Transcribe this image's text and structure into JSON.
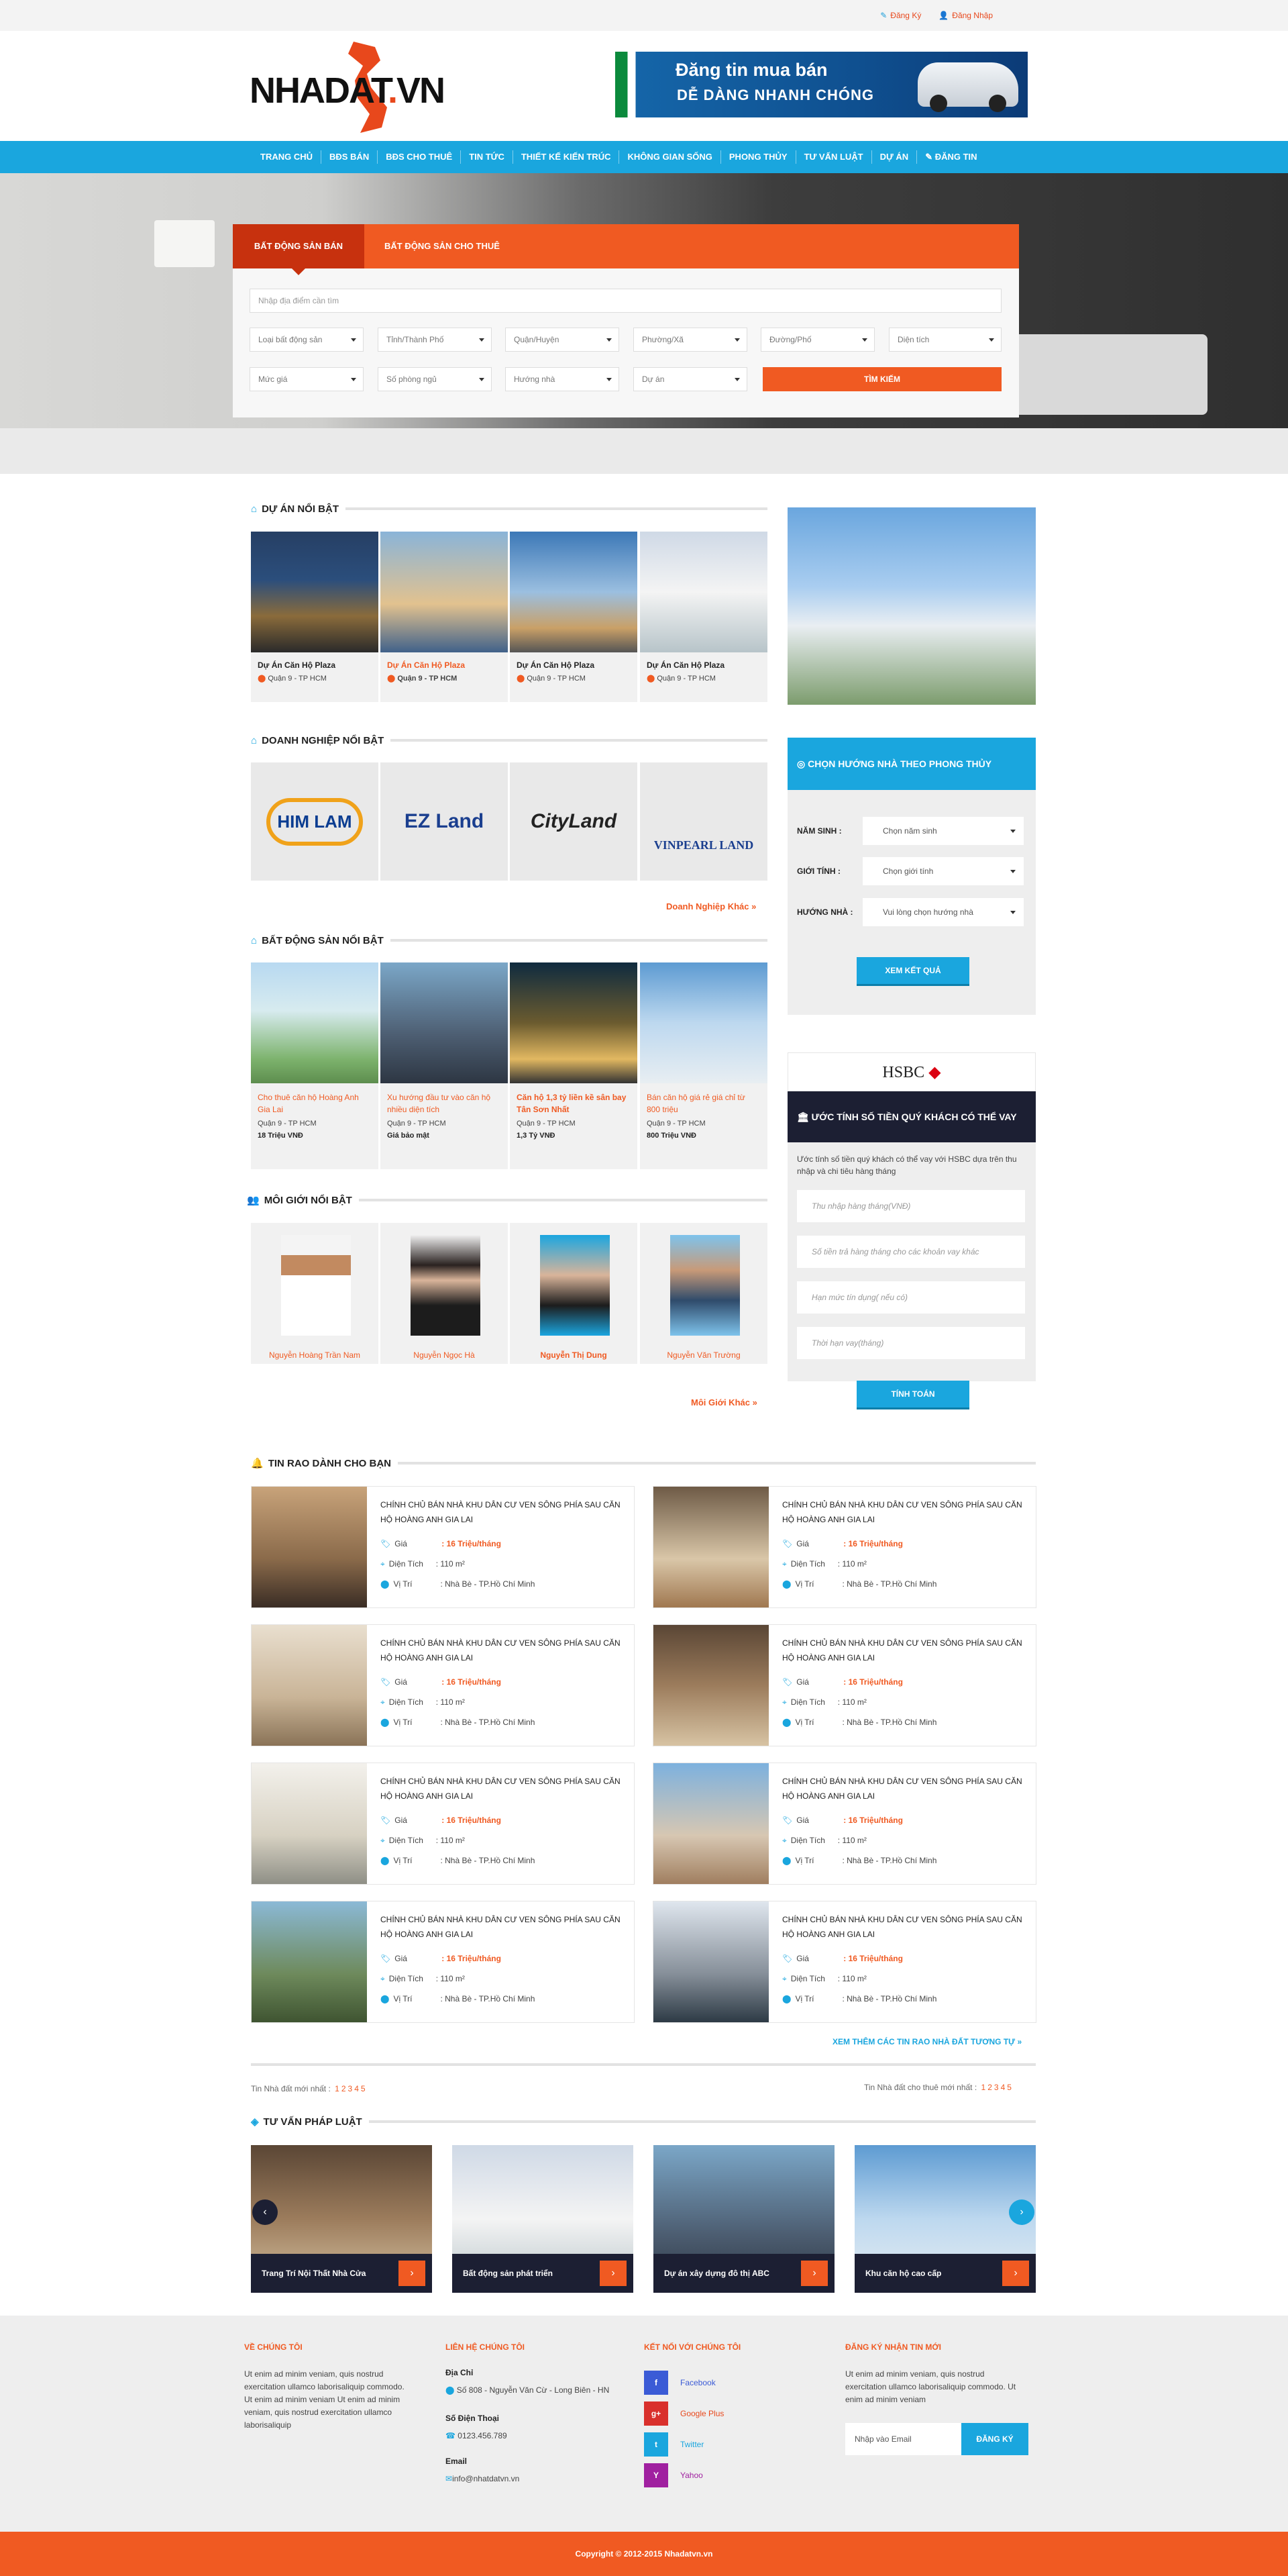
{
  "top": {
    "register": "Đăng Ký",
    "login": "Đăng Nhập"
  },
  "logo": {
    "main": "NHADAT",
    "dot": ".",
    "tld": "VN"
  },
  "banner": {
    "line1": "Đăng tin mua bán",
    "line2": "DỄ DÀNG  NHANH CHÓNG"
  },
  "nav": [
    "TRANG CHỦ",
    "BĐS BÁN",
    "BĐS CHO THUÊ",
    "TIN TỨC",
    "THIẾT KẾ KIẾN TRÚC",
    "KHÔNG GIAN SỐNG",
    "PHONG THỦY",
    "TƯ VẤN LUẬT",
    "DỰ ÁN",
    "ĐĂNG TIN"
  ],
  "search": {
    "tab_sale": "BẤT ĐỘNG SẢN BÁN",
    "tab_rent": "BẤT ĐỘNG SẢN CHO THUÊ",
    "placeholder": "Nhập địa điểm cần tìm",
    "filters_row1": [
      "Loại bất động sản",
      "Tỉnh/Thành Phố",
      "Quận/Huyện",
      "Phường/Xã",
      "Đường/Phố",
      "Diện tích"
    ],
    "filters_row2": [
      "Mức giá",
      "Số phòng ngủ",
      "Hướng nhà",
      "Dự án"
    ],
    "button": "TÌM KIẾM"
  },
  "projects": {
    "heading": "DỰ ÁN NỔI BẬT",
    "items": [
      {
        "title": "Dự Án Căn Hộ Plaza",
        "loc": "Quận 9 - TP HCM"
      },
      {
        "title": "Dự Án Căn Hộ Plaza",
        "loc": "Quận 9 - TP HCM"
      },
      {
        "title": "Dự Án Căn Hộ Plaza",
        "loc": "Quận 9 - TP HCM"
      },
      {
        "title": "Dự Án Căn Hộ Plaza",
        "loc": "Quận 9 - TP HCM"
      }
    ]
  },
  "enterprises": {
    "heading": "DOANH NGHIỆP NỔI BẬT",
    "logos": [
      "HIM LAM",
      "EZ Land",
      "CityLand",
      "VINPEARL LAND"
    ],
    "more": "Doanh Nghiệp Khác »"
  },
  "featured": {
    "heading": "BẤT ĐỘNG SẢN NỔI BẬT",
    "items": [
      {
        "title": "Cho thuê căn hộ Hoàng Anh Gia Lai",
        "loc": "Quận 9 - TP HCM",
        "price": "18 Triệu VNĐ"
      },
      {
        "title": "Xu hướng đầu tư vào căn hộ nhiều diện tích",
        "loc": "Quận 9 - TP HCM",
        "price": "Giá bảo mật"
      },
      {
        "title": "Căn hộ 1,3 tỷ liền kề sân bay Tân Sơn Nhất",
        "loc": "Quận 9 - TP HCM",
        "price": "1,3 Tỷ VNĐ"
      },
      {
        "title": "Bán căn hộ giá rẻ giá chỉ từ 800 triệu",
        "loc": "Quận 9 - TP HCM",
        "price": "800 Triệu VNĐ"
      }
    ]
  },
  "brokers": {
    "heading": "MÔI GIỚI NỔI BẬT",
    "names": [
      "Nguyễn Hoàng Trần Nam",
      "Nguyễn Ngọc Hà",
      "Nguyễn Thị Dung",
      "Nguyễn Văn Trường"
    ],
    "more": "Môi Giới Khác »"
  },
  "fengshui": {
    "heading": "CHỌN HƯỚNG NHÀ THEO PHONG THỦY",
    "labels": [
      "NĂM SINH :",
      "GIỚI TÍNH :",
      "HƯỚNG NHÀ :"
    ],
    "selects": [
      "Chọn năm sinh",
      "Chọn giới tính",
      "Vui lòng chọn hướng nhà"
    ],
    "button": "XEM KẾT QUẢ"
  },
  "hsbc": {
    "logo": "HSBC",
    "heading": "ƯỚC TÍNH SỐ TIỀN QUÝ KHÁCH CÓ THỂ VAY",
    "desc": "Ước tính số tiền quý khách có thể vay với HSBC dựa trên thu nhập và chi tiêu hàng tháng",
    "inputs": [
      "Thu nhập hàng tháng(VNĐ)",
      "Số tiền trả hàng tháng cho các khoản vay khác",
      "Hạn mức tín dụng( nếu có)",
      "Thời hạn vay(tháng)"
    ],
    "button": "TÍNH TOÁN"
  },
  "listings": {
    "heading": "TIN RAO DÀNH CHO BẠN",
    "title": "CHÍNH CHỦ BÁN NHÀ KHU DÂN CƯ VEN SÔNG PHÍA SAU CĂN HỘ HOÀNG ANH GIA LAI",
    "price_label": "Giá",
    "price": ": 16 Triệu/tháng",
    "area_label": "Diện Tích",
    "area": ": 110 m²",
    "loc_label": "Vị Trí",
    "loc": ": Nhà Bè - TP.Hồ Chí Minh",
    "more": "XEM THÊM CÁC TIN RAO NHÀ ĐẤT TƯƠNG TỰ »",
    "pag_left": "Tin Nhà đất mới nhất :",
    "pag_right": "Tin Nhà đất cho thuê mới nhất :",
    "pages": [
      "1",
      "2",
      "3",
      "4",
      "5"
    ]
  },
  "legal": {
    "heading": "TƯ VẤN PHÁP LUẬT",
    "items": [
      "Trang Trí Nội Thất Nhà Cửa",
      "Bất động sản phát triển",
      "Dự án xây dựng đô thị ABC",
      "Khu căn hộ cao cấp"
    ]
  },
  "footer": {
    "about_h": "VỀ CHÚNG TÔI",
    "about": "Ut enim ad minim veniam, quis nostrud exercitation ullamco laborisaliquip commodo. Ut enim ad minim veniam Ut enim ad minim veniam, quis nostrud exercitation ullamco laborisaliquip",
    "contact_h": "LIÊN HỆ CHÚNG TÔI",
    "addr_h": "Địa Chỉ",
    "addr": "Số 808 - Nguyễn Văn Cừ - Long Biên - HN",
    "phone_h": "Số Điện Thoại",
    "phone": "0123.456.789",
    "email_h": "Email",
    "email": "info@nhatdatvn.vn",
    "social_h": "KẾT NỐI VỚI CHÚNG TÔI",
    "social": [
      "Facebook",
      "Google Plus",
      "Twitter",
      "Yahoo"
    ],
    "news_h": "ĐĂNG KÝ NHẬN TIN MỚI",
    "news": "Ut enim ad minim veniam, quis nostrud exercitation ullamco laborisaliquip commodo. Ut enim ad minim veniam",
    "news_placeholder": "Nhập vào Email",
    "news_button": "ĐĂNG KÝ",
    "copyright": "Copyright © 2012-2015 Nhadatvn.vn"
  },
  "colors": {
    "accent": "#f05a22",
    "blue": "#1aa6de",
    "dark": "#1c1f33"
  }
}
